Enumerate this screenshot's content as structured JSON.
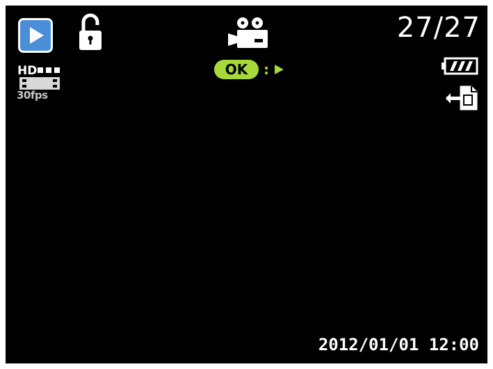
{
  "top_bar": {
    "mode_icon": "playback-mode-icon",
    "lock_icon": "unlock-icon",
    "file_type_icon": "movie-camera-icon",
    "counter": "27/27",
    "battery_icon": "battery-full-icon",
    "output_icon": "tv-output-icon"
  },
  "video_info": {
    "resolution_icon": "hd-video-icon",
    "resolution_label": "HD",
    "fps_label": "30fps"
  },
  "hint": {
    "ok_label": "OK",
    "separator": ":",
    "action_icon": "play-icon"
  },
  "datetime": "2012/01/01 12:00",
  "colors": {
    "background": "#000000",
    "mode_icon_blue": "#4a8ed8",
    "ok_green": "#a7d93a",
    "foreground": "#ffffff"
  }
}
